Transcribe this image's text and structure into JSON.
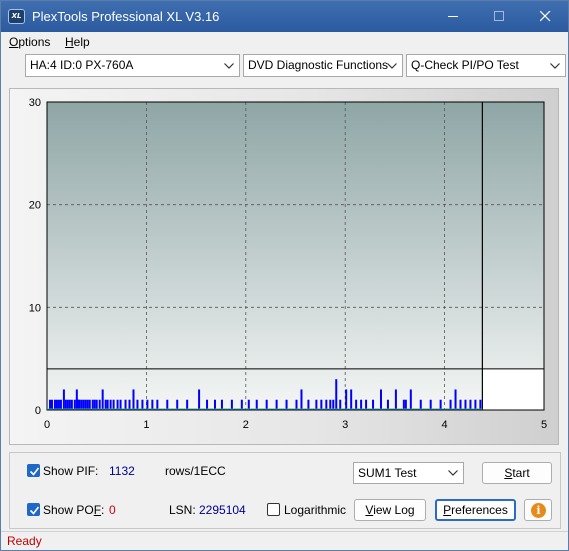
{
  "window": {
    "title": "PlexTools Professional XL V3.16",
    "icon_text": "XL"
  },
  "menu": [
    {
      "label_underlined": "O",
      "label_rest": "ptions"
    },
    {
      "label_underlined": "H",
      "label_rest": "elp"
    }
  ],
  "toolbar": {
    "drive": "HA:4 ID:0  PX-760A",
    "function": "DVD Diagnostic Functions",
    "test": "Q-Check PI/PO Test"
  },
  "chart_data": {
    "type": "bar",
    "xlim": [
      0,
      5
    ],
    "ylim": [
      0,
      30
    ],
    "x_ticks": [
      "0",
      "1",
      "2",
      "3",
      "4",
      "5"
    ],
    "y_ticks": [
      "0",
      "10",
      "20",
      "30"
    ],
    "grid": true,
    "threshold_y": 4,
    "data_end_x": 4.38,
    "series": [
      {
        "color": "#0000ff",
        "x": [
          0.02,
          0.04,
          0.07,
          0.09,
          0.11,
          0.13,
          0.16,
          0.18,
          0.2,
          0.22,
          0.24,
          0.27,
          0.29,
          0.3,
          0.31,
          0.32,
          0.34,
          0.36,
          0.38,
          0.4,
          0.42,
          0.45,
          0.47,
          0.49,
          0.52,
          0.55,
          0.58,
          0.6,
          0.63,
          0.66,
          0.7,
          0.73,
          0.78,
          0.82,
          0.86,
          0.9,
          0.95,
          1.0,
          1.05,
          1.1,
          1.2,
          1.3,
          1.4,
          1.52,
          1.6,
          1.68,
          1.75,
          1.85,
          1.95,
          2.02,
          2.1,
          2.2,
          2.3,
          2.4,
          2.5,
          2.55,
          2.62,
          2.7,
          2.75,
          2.8,
          2.84,
          2.87,
          2.9,
          2.94,
          3.0,
          3.05,
          3.1,
          3.15,
          3.2,
          3.27,
          3.35,
          3.42,
          3.5,
          3.58,
          3.6,
          3.65,
          3.75,
          3.85,
          3.95,
          4.05,
          4.1,
          4.15,
          4.2,
          4.25,
          4.3,
          4.35
        ],
        "values": [
          1,
          1,
          1,
          1,
          1,
          1,
          2,
          1,
          1,
          1,
          1,
          1,
          2,
          1,
          1,
          1,
          1,
          1,
          1,
          1,
          1,
          1,
          1,
          1,
          1,
          2,
          1,
          1,
          1,
          1,
          1,
          1,
          1,
          1,
          2,
          1,
          1,
          1,
          1,
          1,
          1,
          1,
          1,
          2,
          1,
          1,
          1,
          1,
          1,
          1,
          1,
          1,
          1,
          1,
          1,
          2,
          1,
          1,
          1,
          1,
          1,
          1,
          3,
          1,
          2,
          2,
          1,
          1,
          1,
          1,
          2,
          1,
          2,
          1,
          1,
          2,
          1,
          1,
          1,
          1,
          2,
          1,
          1,
          1,
          1,
          1
        ]
      }
    ]
  },
  "controls": {
    "show_pif_label": "Show PIF:",
    "pif_value": "1132",
    "pif_unit": "rows/1ECC",
    "show_pof_label_pre": "Show PO",
    "show_pof_label_underlined": "F",
    "show_pof_label_post": ":",
    "pof_value": "0",
    "lsn_label": "LSN:",
    "lsn_value": "2295104",
    "log_label": "Logarithmic",
    "sum_test": "SUM1 Test",
    "start_u": "S",
    "start_rest": "tart",
    "viewlog_u": "V",
    "viewlog_rest": "iew Log",
    "prefs_u": "P",
    "prefs_rest": "references",
    "info_glyph": "i"
  },
  "status": {
    "text": "Ready"
  }
}
